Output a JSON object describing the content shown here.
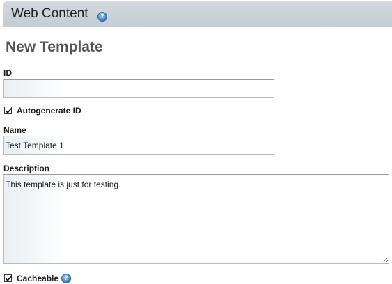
{
  "portlet": {
    "title": "Web Content",
    "help_icon": "question-circle-icon"
  },
  "page": {
    "title": "New Template"
  },
  "form": {
    "id": {
      "label": "ID",
      "value": ""
    },
    "autogenerate_id": {
      "label": "Autogenerate ID",
      "checked": true
    },
    "name": {
      "label": "Name",
      "value": "Test Template 1"
    },
    "description": {
      "label": "Description",
      "value": "This template is just for testing."
    },
    "cacheable": {
      "label": "Cacheable",
      "checked": true,
      "help_icon": "question-circle-icon"
    }
  },
  "colors": {
    "header_bg": "#c9d1d6",
    "page_title": "#555555",
    "help_icon": "#3f7cc4"
  }
}
